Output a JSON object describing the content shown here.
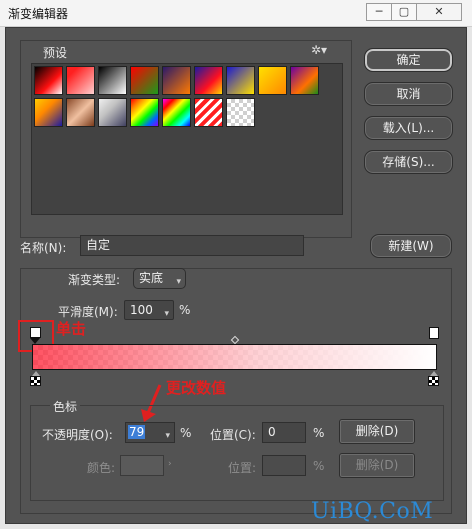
{
  "window": {
    "title": "渐变编辑器",
    "minimize_icon": "minimize-icon",
    "maximize_icon": "maximize-icon",
    "close_icon": "close-icon",
    "min_glyph": "─",
    "max_glyph": "▢",
    "close_glyph": "✕"
  },
  "presets": {
    "label": "预设",
    "menu_glyph": "✲▾",
    "swatches": [
      "linear-gradient(135deg,#000 0%,#ff1010 60%,#fff 100%)",
      "linear-gradient(135deg,#ff2020 20%,#ffd0d0 100%)",
      "linear-gradient(135deg,#000 0%,#fff 100%)",
      "linear-gradient(135deg,#ff0000 0%,#1a9a1a 100%)",
      "linear-gradient(135deg,#2a1a6a 0%,#ff7a00 100%)",
      "linear-gradient(135deg,#1a1aa0 0%,#ff1020 60%,#ffd800 100%)",
      "linear-gradient(135deg,#1a1ad0 0%,#ffe000 100%)",
      "linear-gradient(135deg,#ffe000 0%,#ff8800 100%)",
      "linear-gradient(135deg,#6a00a0 0%,#ff7000 60%,#1a8a1a 100%)",
      "linear-gradient(135deg,#ffcc00 0%,#ff8800 40%,#1a1aa0 100%)",
      "linear-gradient(135deg,#8a4a2a 0%,#f0c0a0 50%,#7a3a1a 100%)",
      "linear-gradient(135deg,#f0f0f0 0%,#c0c0c0 40%,#404060 100%)",
      "linear-gradient(135deg,#ff0000,#ff8800,#ffff00,#00ff00,#0066ff,#8800ff)",
      "linear-gradient(135deg,#ff00ff,#ff0000,#ffff00,#00ff00,#00ffff,#0000ff)",
      "repeating-linear-gradient(135deg,#ff2020 0 4px,#ffffff 4px 7px)",
      "repeating-conic-gradient(#cfcfcf 0 25%,#ffffff 0 50%) 0 0/8px 8px"
    ]
  },
  "buttons": {
    "ok": "确定",
    "cancel": "取消",
    "load": "载入(L)...",
    "save": "存储(S)...",
    "new": "新建(W)",
    "delete": "删除(D)",
    "delete_disabled": "删除(D)"
  },
  "name": {
    "label": "名称(N):",
    "value": "自定"
  },
  "gradient": {
    "type_label": "渐变类型:",
    "type_value": "实底",
    "smooth_label": "平滑度(M):",
    "smooth_value": "100",
    "smooth_unit": "%",
    "bar_css": "linear-gradient(90deg, rgba(255,40,60,0.8) 0%, rgba(255,200,205,0.85) 55%, #ffffff 100%)"
  },
  "stops": {
    "group_label": "色标",
    "opacity_label": "不透明度(O):",
    "opacity_value": "79",
    "opacity_unit": "%",
    "location_label": "位置(C):",
    "location_value": "0",
    "location_unit": "%",
    "color_label": "颜色:",
    "color_location_label": "位置:",
    "color_location_unit": "%"
  },
  "annotations": {
    "click": "单击",
    "change_value": "更改数值"
  },
  "watermark": "UiBQ.CoM",
  "colors": {
    "dialog_bg": "#535353",
    "annotation_red": "#e02020",
    "selected_blue": "#3d7ed6",
    "watermark_blue": "#2b8ad6"
  }
}
